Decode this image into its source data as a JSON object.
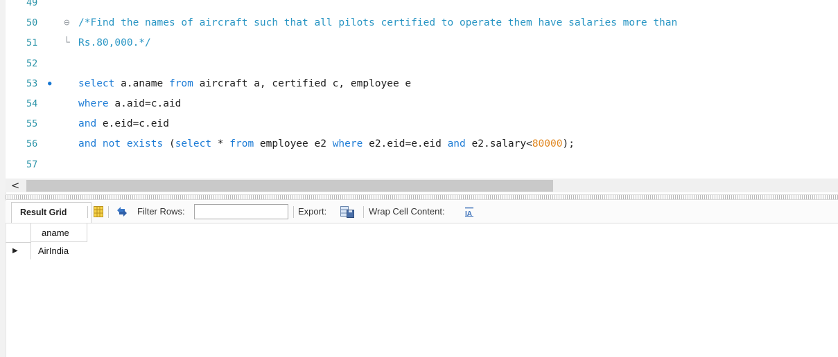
{
  "editor": {
    "lines": [
      {
        "num": "49",
        "tokens": []
      },
      {
        "num": "50",
        "tokens": [
          {
            "t": "/*Find the names of aircraft such that all pilots certified to operate them have salaries more than",
            "c": "cm"
          }
        ]
      },
      {
        "num": "51",
        "tokens": [
          {
            "t": "Rs.80,000.*/",
            "c": "cm"
          }
        ]
      },
      {
        "num": "52",
        "tokens": []
      },
      {
        "num": "53",
        "tokens": [
          {
            "t": "select",
            "c": "kw"
          },
          {
            "t": " a.aname ",
            "c": "id"
          },
          {
            "t": "from",
            "c": "kw"
          },
          {
            "t": " aircraft a, certified c, employee e",
            "c": "id"
          }
        ]
      },
      {
        "num": "54",
        "tokens": [
          {
            "t": "where",
            "c": "kw"
          },
          {
            "t": " a.aid=c.aid",
            "c": "id"
          }
        ]
      },
      {
        "num": "55",
        "tokens": [
          {
            "t": "and",
            "c": "kw"
          },
          {
            "t": " e.eid=c.eid",
            "c": "id"
          }
        ]
      },
      {
        "num": "56",
        "tokens": [
          {
            "t": "and not exists",
            "c": "kw"
          },
          {
            "t": " (",
            "c": "id"
          },
          {
            "t": "select",
            "c": "kw"
          },
          {
            "t": " * ",
            "c": "id"
          },
          {
            "t": "from",
            "c": "kw"
          },
          {
            "t": " employee e2 ",
            "c": "id"
          },
          {
            "t": "where",
            "c": "kw"
          },
          {
            "t": " e2.eid=e.eid ",
            "c": "id"
          },
          {
            "t": "and",
            "c": "kw"
          },
          {
            "t": " e2.salary<",
            "c": "id"
          },
          {
            "t": "80000",
            "c": "num"
          },
          {
            "t": ");",
            "c": "id"
          }
        ]
      },
      {
        "num": "57",
        "tokens": []
      }
    ],
    "colors": {
      "comment": "#2a96c4",
      "keyword": "#1f7dd6",
      "number": "#e0861f",
      "line_number": "#2a93a8"
    }
  },
  "scrollbar": {
    "left_arrow": "<"
  },
  "toolbar": {
    "result_grid_label": "Result Grid",
    "filter_rows_label": "Filter Rows:",
    "filter_rows_value": "",
    "export_label": "Export:",
    "wrap_label": "Wrap Cell Content:",
    "icons": [
      "grid-layout-icon",
      "refresh-icon",
      "export-icon",
      "wrap-text-icon"
    ]
  },
  "grid": {
    "columns": [
      "aname"
    ],
    "rows": [
      [
        "AirIndia"
      ]
    ],
    "row_marker": "▶"
  }
}
